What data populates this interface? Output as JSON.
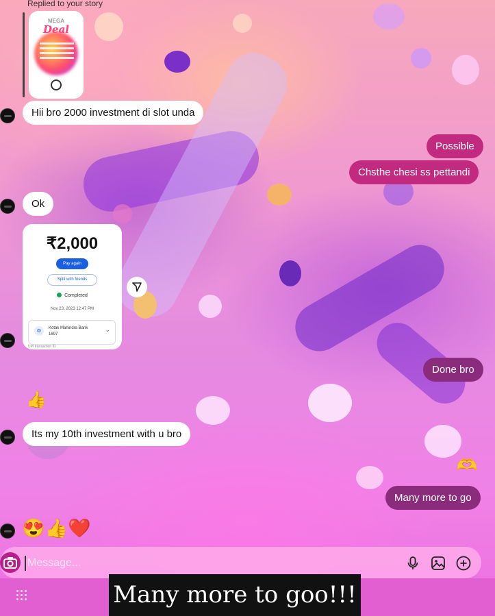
{
  "story_reply": {
    "label": "Replied to your story",
    "thumb_title_small": "MEGA",
    "thumb_title": "Deal"
  },
  "messages": {
    "in_1": "Hii bro 2000 investment di slot unda",
    "out_1": "Possible",
    "out_2": "Chsthe chesi ss pettandi",
    "in_2": "Ok",
    "out_3": "Done bro",
    "in_3": "Its my 10th investment with u bro",
    "out_4": "Many more to go"
  },
  "payment_card": {
    "amount": "₹2,000",
    "primary_button": "Pay again",
    "secondary_button": "Split with friends",
    "status": "Completed",
    "date": "Nov 23, 2023 12:47 PM",
    "bank_name": "Kotak Mahindra Bank 1697",
    "footer": "UPI transaction ID"
  },
  "reactions": {
    "thumbs_up": "👍",
    "heart_hands": "🫶",
    "last_emojis": "😍👍❤️"
  },
  "composer": {
    "placeholder": "Message..."
  },
  "caption": {
    "text": "Many more to goo!!!"
  },
  "icons": [
    "camera-icon",
    "microphone-icon",
    "gallery-icon",
    "add-icon",
    "share-icon",
    "apps-grid-icon"
  ],
  "colors": {
    "outgoing_bubble": "#c22a7f",
    "outgoing_bubble_dark": "#8a2b7b",
    "camera_button": "#b5208a",
    "pay_button": "#1a5fe0"
  }
}
